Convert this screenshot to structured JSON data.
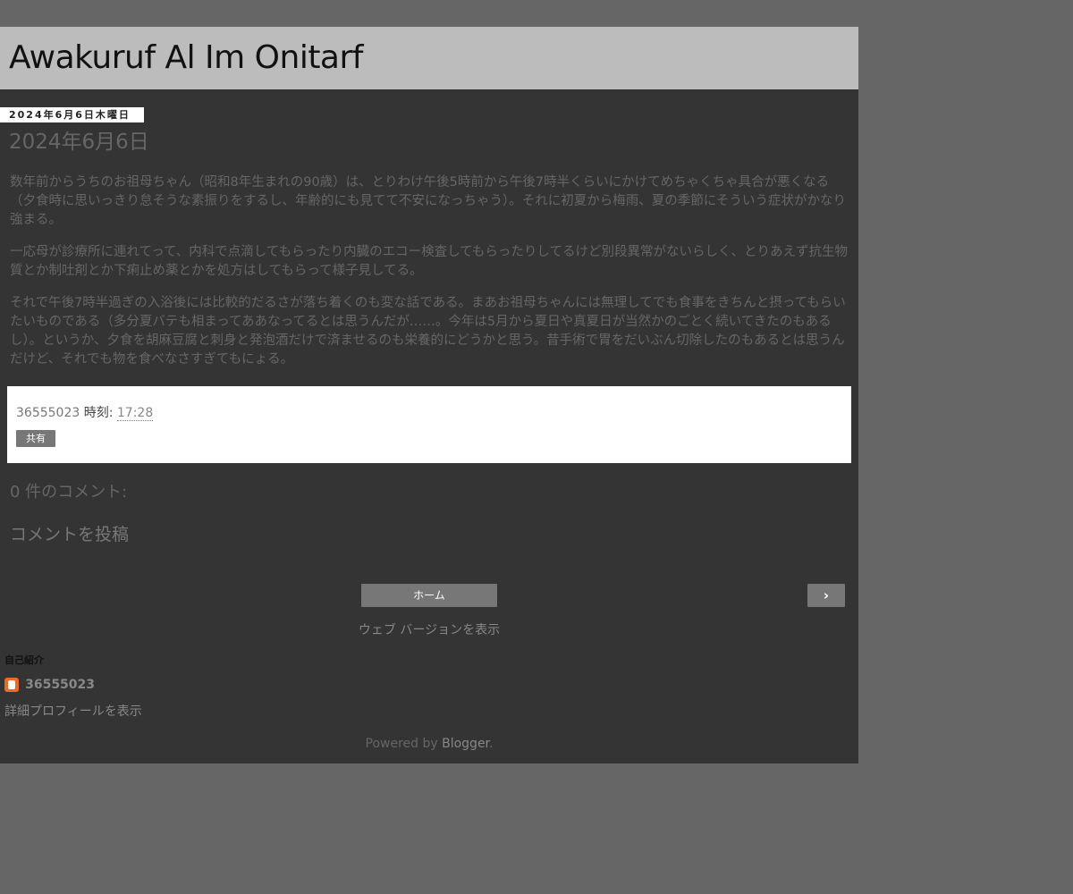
{
  "header": {
    "blog_title": "Awakuruf Al Im Onitarf"
  },
  "post": {
    "date_header": "2024年6月6日木曜日",
    "title": "2024年6月6日",
    "paragraphs": [
      "数年前からうちのお祖母ちゃん（昭和8年生まれの90歳）は、とりわけ午後5時前から午後7時半くらいにかけてめちゃくちゃ具合が悪くなる（夕食時に思いっきり怠そうな素振りをするし、年齢的にも見てて不安になっちゃう）。それに初夏から梅雨、夏の季節にそういう症状がかなり強まる。",
      "一応母が診療所に連れてって、内科で点滴してもらったり内臓のエコー検査してもらったりしてるけど別段異常がないらしく、とりあえず抗生物質とか制吐剤とか下痢止め薬とかを処方はしてもらって様子見してる。",
      "それで午後7時半過ぎの入浴後には比較的だるさが落ち着くのも変な話である。まあお祖母ちゃんには無理してでも食事をきちんと摂ってもらいたいものである（多分夏バテも相まってああなってるとは思うんだが……。今年は5月から夏日や真夏日が当然かのごとく続いてきたのもあるし）。というか、夕食を胡麻豆腐と刺身と発泡酒だけで済ませるのも栄養的にどうかと思う。昔手術で胃をだいぶん切除したのもあるとは思うんだけど、それでも物を食べなさすぎてもにょる。"
    ],
    "footer": {
      "author": "36555023",
      "time_label": "時刻:",
      "time": "17:28",
      "share_label": "共有"
    }
  },
  "comments": {
    "heading": "0 件のコメント:",
    "post_comment_label": "コメントを投稿"
  },
  "navigation": {
    "home_label": "ホーム",
    "next_label": "›",
    "web_version_label": "ウェブ バージョンを表示"
  },
  "profile": {
    "heading": "自己紹介",
    "icon": "blogger-icon",
    "name": "36555023",
    "view_profile_label": "詳細プロフィールを表示"
  },
  "attribution": {
    "powered_by_label": "Powered by",
    "blogger_label": "Blogger",
    "period": "."
  },
  "colors": {
    "page_background": "#666666",
    "content_background": "#343434",
    "header_background": "#bcbcbc",
    "button_background": "#777777",
    "blogger_orange": "#f06a1e"
  }
}
